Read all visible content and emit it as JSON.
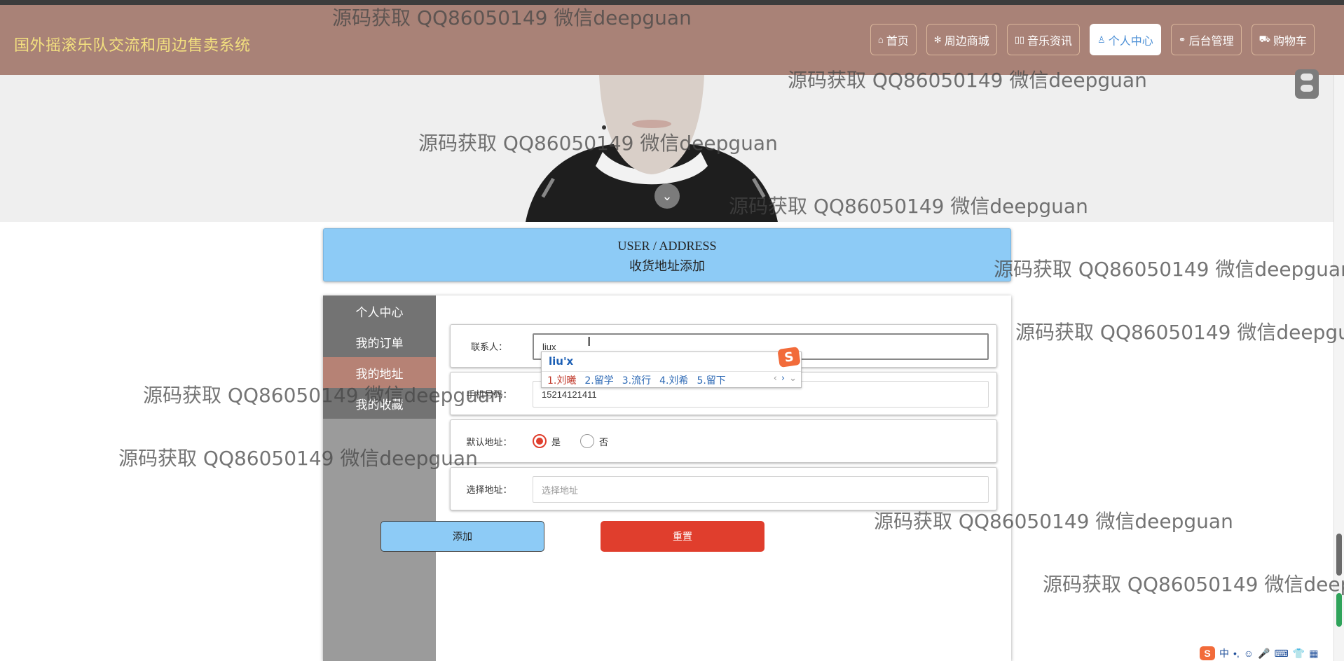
{
  "site": {
    "title": "国外摇滚乐队交流和周边售卖系统"
  },
  "nav": {
    "items": [
      {
        "icon": "home-icon",
        "label": "首页"
      },
      {
        "icon": "gear-icon",
        "label": "周边商城"
      },
      {
        "icon": "list-icon",
        "label": "音乐资讯"
      },
      {
        "icon": "user-icon",
        "label": "个人中心",
        "active": true
      },
      {
        "icon": "link-icon",
        "label": "后台管理"
      },
      {
        "icon": "cart-icon",
        "label": "购物车"
      }
    ]
  },
  "header": {
    "en": "USER / ADDRESS",
    "cn": "收货地址添加"
  },
  "sidebar": {
    "items": [
      {
        "label": "个人中心"
      },
      {
        "label": "我的订单"
      },
      {
        "label": "我的地址",
        "active": true
      },
      {
        "label": "我的收藏"
      }
    ]
  },
  "form": {
    "contact_label": "联系人：",
    "contact_value": "liux",
    "phone_label": "手机号码：",
    "phone_value": "15214121411",
    "default_label": "默认地址：",
    "default_yes": "是",
    "default_no": "否",
    "default_selected": "是",
    "address_label": "选择地址：",
    "address_placeholder": "选择地址",
    "add_button": "添加",
    "reset_button": "重置"
  },
  "ime": {
    "composition": "liu'x",
    "candidates": [
      "1.刘曦",
      "2.留学",
      "3.流行",
      "4.刘希",
      "5.留下"
    ]
  },
  "watermark": "源码获取 QQ86050149 微信deepguan",
  "tray": {
    "text": "中"
  },
  "colors": {
    "nav": "#a98277",
    "accent": "#8dcbf6",
    "danger": "#e03e2d",
    "title": "#f3e07f"
  }
}
